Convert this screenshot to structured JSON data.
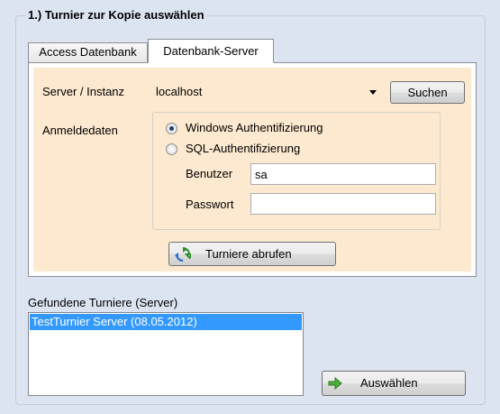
{
  "group": {
    "title": "1.) Turnier zur Kopie auswählen"
  },
  "tabs": [
    {
      "label": "Access Datenbank",
      "active": false
    },
    {
      "label": "Datenbank-Server",
      "active": true
    }
  ],
  "server": {
    "label": "Server / Instanz",
    "value": "localhost",
    "search_button": "Suchen"
  },
  "credentials": {
    "label": "Anmeldedaten",
    "options": [
      {
        "label": "Windows Authentifizierung",
        "checked": true
      },
      {
        "label": "SQL-Authentifizierung",
        "checked": false
      }
    ],
    "user_label": "Benutzer",
    "user_value": "sa",
    "password_label": "Passwort",
    "password_value": ""
  },
  "fetch_button": "Turniere abrufen",
  "found": {
    "label": "Gefundene Turniere (Server)",
    "items": [
      "TestTurnier Server (08.05.2012)"
    ]
  },
  "select_button": "Auswählen",
  "colors": {
    "panel": "#fde9cf",
    "selection": "#3399ff",
    "background": "#dce4f1"
  }
}
